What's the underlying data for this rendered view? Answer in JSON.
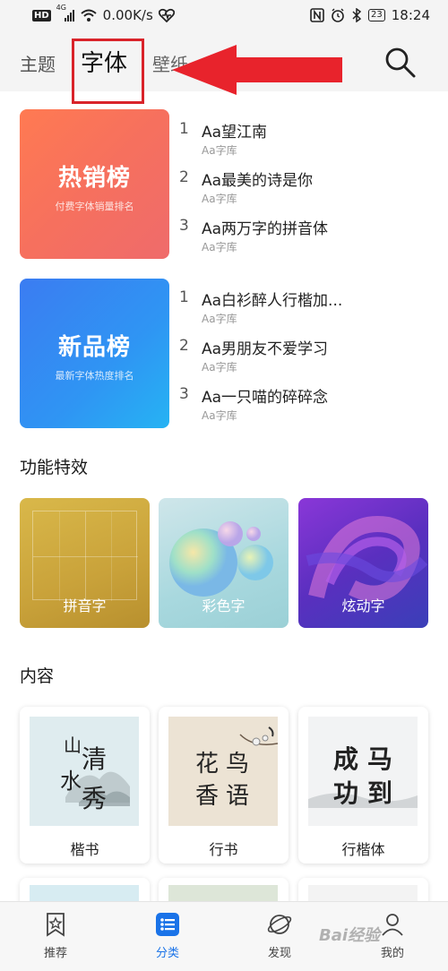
{
  "status_bar": {
    "network_badge": "HD",
    "signal_type": "4G",
    "speed": "0.00K/s",
    "battery": "23",
    "time": "18:24",
    "icons": [
      "nfc-icon",
      "alarm-icon",
      "bluetooth-icon",
      "heart-icon"
    ]
  },
  "tabs": {
    "items": [
      "主题",
      "字体",
      "壁纸"
    ],
    "active": "字体"
  },
  "rankings": [
    {
      "title": "热销榜",
      "subtitle": "付费字体销量排名",
      "items": [
        {
          "rank": "1",
          "name": "Aa望江南",
          "source": "Aa字库"
        },
        {
          "rank": "2",
          "name": "Aa最美的诗是你",
          "source": "Aa字库"
        },
        {
          "rank": "3",
          "name": "Aa两万字的拼音体",
          "source": "Aa字库"
        }
      ]
    },
    {
      "title": "新品榜",
      "subtitle": "最新字体热度排名",
      "items": [
        {
          "rank": "1",
          "name": "Aa白衫醉人行楷加...",
          "source": "Aa字库"
        },
        {
          "rank": "2",
          "name": "Aa男朋友不爱学习",
          "source": "Aa字库"
        },
        {
          "rank": "3",
          "name": "Aa一只喵的碎碎念",
          "source": "Aa字库"
        }
      ]
    }
  ],
  "features": {
    "title": "功能特效",
    "items": [
      "拼音字",
      "彩色字",
      "炫动字"
    ]
  },
  "content": {
    "title": "内容",
    "items": [
      {
        "label": "楷书",
        "art": [
          "山",
          "清",
          "水",
          "秀"
        ]
      },
      {
        "label": "行书",
        "art": [
          "花",
          "鸟",
          "香",
          "语"
        ]
      },
      {
        "label": "行楷体",
        "art": [
          "成",
          "马",
          "功",
          "到"
        ]
      }
    ]
  },
  "bottom_nav": {
    "items": [
      {
        "label": "推荐",
        "icon": "star-bookmark-icon"
      },
      {
        "label": "分类",
        "icon": "category-list-icon"
      },
      {
        "label": "发现",
        "icon": "planet-icon"
      },
      {
        "label": "我的",
        "icon": "person-icon"
      }
    ],
    "active": "分类"
  },
  "watermark": "Bai经验",
  "colors": {
    "accent": "#1a73e8",
    "highlight_box": "#d9232a",
    "hot_card": "#f6705e",
    "new_card": "#2f95f3"
  }
}
